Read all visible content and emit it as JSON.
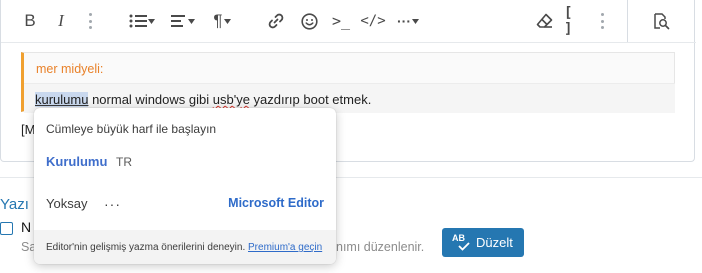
{
  "toolbar": {
    "bold_label": "B",
    "italic_label": "I",
    "paragraph_label": "¶",
    "terminal_label": ">_",
    "code_label": "</>",
    "more_label": "···",
    "brackets_label": "[ ]"
  },
  "quote": {
    "author": "mer midyeli:",
    "text_highlighted": "kurulumu",
    "text_mid": " normal windows gibi ",
    "text_squiggle": "usb'ye",
    "text_end": "  yazdırıp boot etmek."
  },
  "editor": {
    "below_quote_text": "[M"
  },
  "background": {
    "section_title": "Yazı",
    "option_label": "N",
    "option_desc_start": "Sa",
    "option_desc_end": "nımı düzenlenir.",
    "fix_button_label": "Düzelt",
    "fix_button_badge": "AB"
  },
  "popup": {
    "title": "Cümleye büyük harf ile başlayın",
    "suggestion": "Kurulumu",
    "language": "TR",
    "ignore_label": "Yoksay",
    "more_label": "···",
    "brand": "Microsoft Editor",
    "footer_text": "Editor'nin gelişmiş yazma önerilerini deneyin.",
    "footer_link": "Premium'a geçin"
  },
  "colors": {
    "accent": "#2577b1",
    "quote_border": "#f0a030",
    "quote_author": "#e9822a",
    "popup_link": "#2e6bc9",
    "spell_error": "#d8332b"
  }
}
